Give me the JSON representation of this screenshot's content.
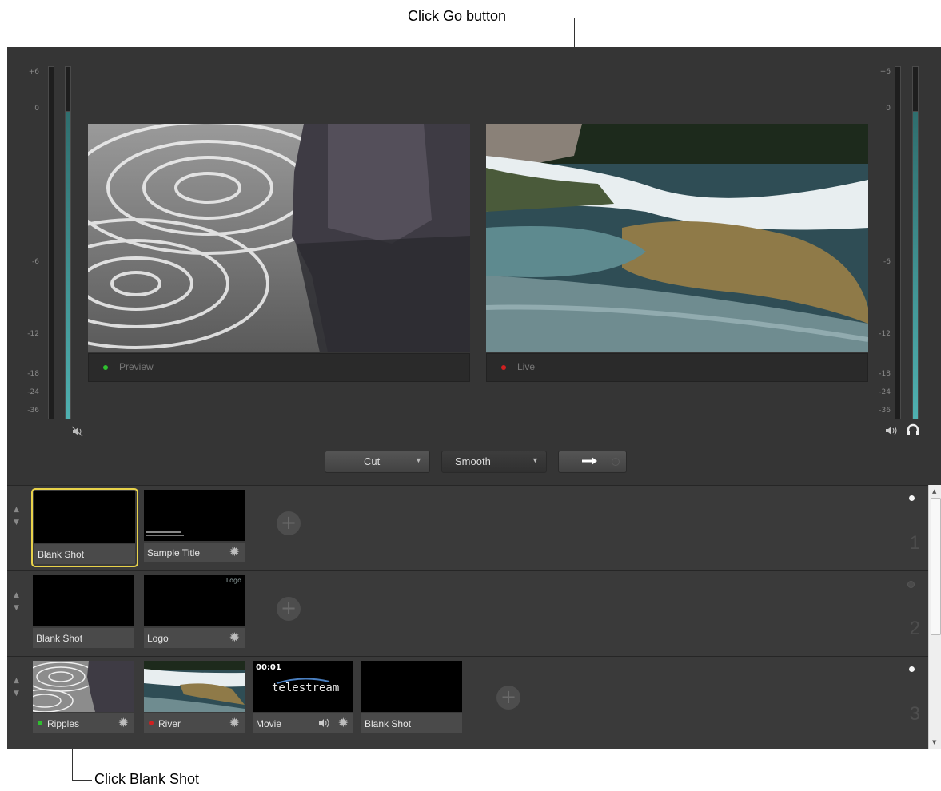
{
  "callouts": {
    "go_button": "Click Go button",
    "blank_shot": "Click Blank Shot"
  },
  "meters": {
    "left_scale": [
      "+6",
      "0",
      "-6",
      "-12",
      "-18",
      "-24",
      "-36"
    ],
    "right_scale": [
      "+6",
      "0",
      "-6",
      "-12",
      "-18",
      "-24",
      "-36"
    ],
    "left_icon": "speaker-muted-icon",
    "right_icons": [
      "speaker-icon",
      "headphones-icon"
    ]
  },
  "preview": {
    "label": "Preview",
    "status_color": "#2fbf2f"
  },
  "live": {
    "label": "Live",
    "status_color": "#d02020"
  },
  "controls": {
    "transition": "Cut",
    "speed": "Smooth",
    "go_icon": "arrow-right-icon"
  },
  "layers": [
    {
      "number": "1",
      "shots": [
        {
          "name": "Blank Shot",
          "selected": true
        },
        {
          "name": "Sample Title",
          "thumb_text": "Sample Title text"
        }
      ]
    },
    {
      "number": "2",
      "shots": [
        {
          "name": "Blank Shot"
        },
        {
          "name": "Logo",
          "thumb_text": "Logo"
        }
      ]
    },
    {
      "number": "3",
      "shots": [
        {
          "name": "Ripples",
          "status_color": "#2fbf2f"
        },
        {
          "name": "River",
          "status_color": "#d02020"
        },
        {
          "name": "Movie",
          "timecode": "00:01",
          "thumb_text": "telestream"
        },
        {
          "name": "Blank Shot"
        }
      ]
    }
  ]
}
